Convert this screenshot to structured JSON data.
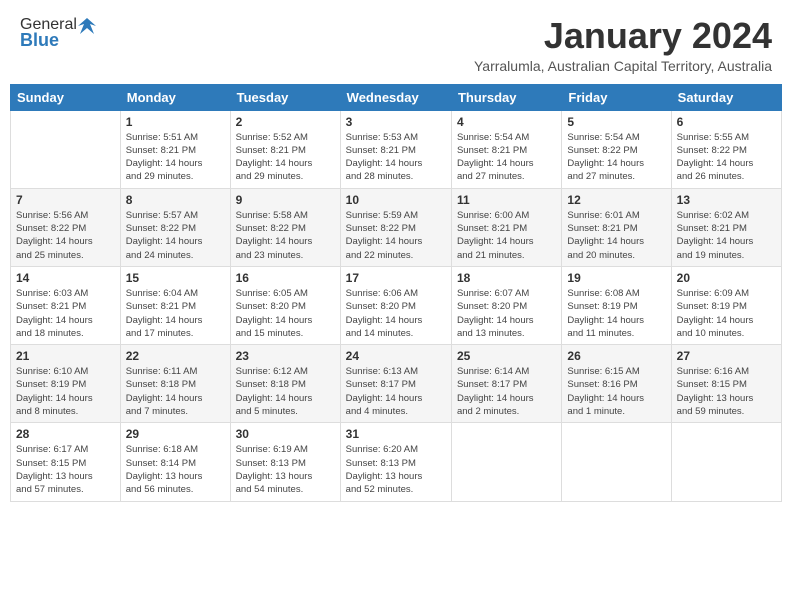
{
  "header": {
    "logo_general": "General",
    "logo_blue": "Blue",
    "month": "January 2024",
    "location": "Yarralumla, Australian Capital Territory, Australia"
  },
  "days_of_week": [
    "Sunday",
    "Monday",
    "Tuesday",
    "Wednesday",
    "Thursday",
    "Friday",
    "Saturday"
  ],
  "weeks": [
    [
      {
        "day": "",
        "info": ""
      },
      {
        "day": "1",
        "info": "Sunrise: 5:51 AM\nSunset: 8:21 PM\nDaylight: 14 hours\nand 29 minutes."
      },
      {
        "day": "2",
        "info": "Sunrise: 5:52 AM\nSunset: 8:21 PM\nDaylight: 14 hours\nand 29 minutes."
      },
      {
        "day": "3",
        "info": "Sunrise: 5:53 AM\nSunset: 8:21 PM\nDaylight: 14 hours\nand 28 minutes."
      },
      {
        "day": "4",
        "info": "Sunrise: 5:54 AM\nSunset: 8:21 PM\nDaylight: 14 hours\nand 27 minutes."
      },
      {
        "day": "5",
        "info": "Sunrise: 5:54 AM\nSunset: 8:22 PM\nDaylight: 14 hours\nand 27 minutes."
      },
      {
        "day": "6",
        "info": "Sunrise: 5:55 AM\nSunset: 8:22 PM\nDaylight: 14 hours\nand 26 minutes."
      }
    ],
    [
      {
        "day": "7",
        "info": "Sunrise: 5:56 AM\nSunset: 8:22 PM\nDaylight: 14 hours\nand 25 minutes."
      },
      {
        "day": "8",
        "info": "Sunrise: 5:57 AM\nSunset: 8:22 PM\nDaylight: 14 hours\nand 24 minutes."
      },
      {
        "day": "9",
        "info": "Sunrise: 5:58 AM\nSunset: 8:22 PM\nDaylight: 14 hours\nand 23 minutes."
      },
      {
        "day": "10",
        "info": "Sunrise: 5:59 AM\nSunset: 8:22 PM\nDaylight: 14 hours\nand 22 minutes."
      },
      {
        "day": "11",
        "info": "Sunrise: 6:00 AM\nSunset: 8:21 PM\nDaylight: 14 hours\nand 21 minutes."
      },
      {
        "day": "12",
        "info": "Sunrise: 6:01 AM\nSunset: 8:21 PM\nDaylight: 14 hours\nand 20 minutes."
      },
      {
        "day": "13",
        "info": "Sunrise: 6:02 AM\nSunset: 8:21 PM\nDaylight: 14 hours\nand 19 minutes."
      }
    ],
    [
      {
        "day": "14",
        "info": "Sunrise: 6:03 AM\nSunset: 8:21 PM\nDaylight: 14 hours\nand 18 minutes."
      },
      {
        "day": "15",
        "info": "Sunrise: 6:04 AM\nSunset: 8:21 PM\nDaylight: 14 hours\nand 17 minutes."
      },
      {
        "day": "16",
        "info": "Sunrise: 6:05 AM\nSunset: 8:20 PM\nDaylight: 14 hours\nand 15 minutes."
      },
      {
        "day": "17",
        "info": "Sunrise: 6:06 AM\nSunset: 8:20 PM\nDaylight: 14 hours\nand 14 minutes."
      },
      {
        "day": "18",
        "info": "Sunrise: 6:07 AM\nSunset: 8:20 PM\nDaylight: 14 hours\nand 13 minutes."
      },
      {
        "day": "19",
        "info": "Sunrise: 6:08 AM\nSunset: 8:19 PM\nDaylight: 14 hours\nand 11 minutes."
      },
      {
        "day": "20",
        "info": "Sunrise: 6:09 AM\nSunset: 8:19 PM\nDaylight: 14 hours\nand 10 minutes."
      }
    ],
    [
      {
        "day": "21",
        "info": "Sunrise: 6:10 AM\nSunset: 8:19 PM\nDaylight: 14 hours\nand 8 minutes."
      },
      {
        "day": "22",
        "info": "Sunrise: 6:11 AM\nSunset: 8:18 PM\nDaylight: 14 hours\nand 7 minutes."
      },
      {
        "day": "23",
        "info": "Sunrise: 6:12 AM\nSunset: 8:18 PM\nDaylight: 14 hours\nand 5 minutes."
      },
      {
        "day": "24",
        "info": "Sunrise: 6:13 AM\nSunset: 8:17 PM\nDaylight: 14 hours\nand 4 minutes."
      },
      {
        "day": "25",
        "info": "Sunrise: 6:14 AM\nSunset: 8:17 PM\nDaylight: 14 hours\nand 2 minutes."
      },
      {
        "day": "26",
        "info": "Sunrise: 6:15 AM\nSunset: 8:16 PM\nDaylight: 14 hours\nand 1 minute."
      },
      {
        "day": "27",
        "info": "Sunrise: 6:16 AM\nSunset: 8:15 PM\nDaylight: 13 hours\nand 59 minutes."
      }
    ],
    [
      {
        "day": "28",
        "info": "Sunrise: 6:17 AM\nSunset: 8:15 PM\nDaylight: 13 hours\nand 57 minutes."
      },
      {
        "day": "29",
        "info": "Sunrise: 6:18 AM\nSunset: 8:14 PM\nDaylight: 13 hours\nand 56 minutes."
      },
      {
        "day": "30",
        "info": "Sunrise: 6:19 AM\nSunset: 8:13 PM\nDaylight: 13 hours\nand 54 minutes."
      },
      {
        "day": "31",
        "info": "Sunrise: 6:20 AM\nSunset: 8:13 PM\nDaylight: 13 hours\nand 52 minutes."
      },
      {
        "day": "",
        "info": ""
      },
      {
        "day": "",
        "info": ""
      },
      {
        "day": "",
        "info": ""
      }
    ]
  ]
}
